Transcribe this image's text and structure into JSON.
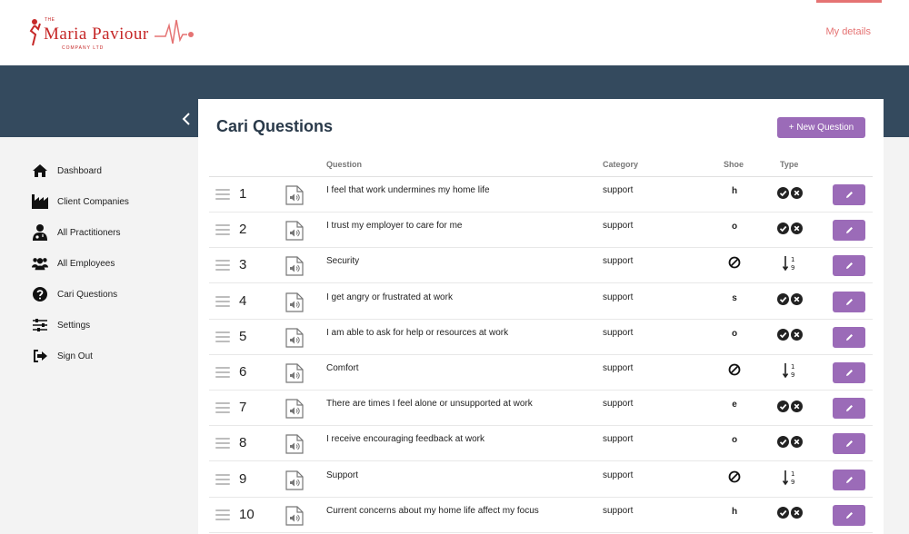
{
  "header": {
    "logo_the": "THE",
    "logo_name": "Maria Paviour",
    "logo_sub": "COMPANY LTD",
    "my_details": "My details",
    "accent_color": "#e57373"
  },
  "sidebar": {
    "collapse_icon": "chevron-left-icon",
    "items": [
      {
        "label": "Dashboard",
        "icon": "home-icon"
      },
      {
        "label": "Client Companies",
        "icon": "factory-icon"
      },
      {
        "label": "All Practitioners",
        "icon": "doctor-icon"
      },
      {
        "label": "All Employees",
        "icon": "users-icon"
      },
      {
        "label": "Cari Questions",
        "icon": "question-circle-icon"
      },
      {
        "label": "Settings",
        "icon": "sliders-icon"
      },
      {
        "label": "Sign Out",
        "icon": "sign-out-icon"
      }
    ]
  },
  "main": {
    "title": "Cari Questions",
    "new_button": "+ New Question",
    "button_color": "#9b6bb8",
    "columns": {
      "question": "Question",
      "category": "Category",
      "shoe": "Shoe",
      "type": "Type"
    },
    "rows": [
      {
        "num": "1",
        "question": "I feel that work undermines my home life",
        "category": "support",
        "shoe": "h",
        "type": "yes-no"
      },
      {
        "num": "2",
        "question": "I trust my employer to care for me",
        "category": "support",
        "shoe": "o",
        "type": "yes-no"
      },
      {
        "num": "3",
        "question": "Security",
        "category": "support",
        "shoe": "none",
        "type": "scale"
      },
      {
        "num": "4",
        "question": "I get angry or frustrated at work",
        "category": "support",
        "shoe": "s",
        "type": "yes-no"
      },
      {
        "num": "5",
        "question": "I am able to ask for help or resources at work",
        "category": "support",
        "shoe": "o",
        "type": "yes-no"
      },
      {
        "num": "6",
        "question": "Comfort",
        "category": "support",
        "shoe": "none",
        "type": "scale"
      },
      {
        "num": "7",
        "question": "There are times I feel alone or unsupported at work",
        "category": "support",
        "shoe": "e",
        "type": "yes-no"
      },
      {
        "num": "8",
        "question": "I receive encouraging feedback at work",
        "category": "support",
        "shoe": "o",
        "type": "yes-no"
      },
      {
        "num": "9",
        "question": "Support",
        "category": "support",
        "shoe": "none",
        "type": "scale"
      },
      {
        "num": "10",
        "question": "Current concerns about my home life affect my focus",
        "category": "support",
        "shoe": "h",
        "type": "yes-no"
      }
    ]
  }
}
